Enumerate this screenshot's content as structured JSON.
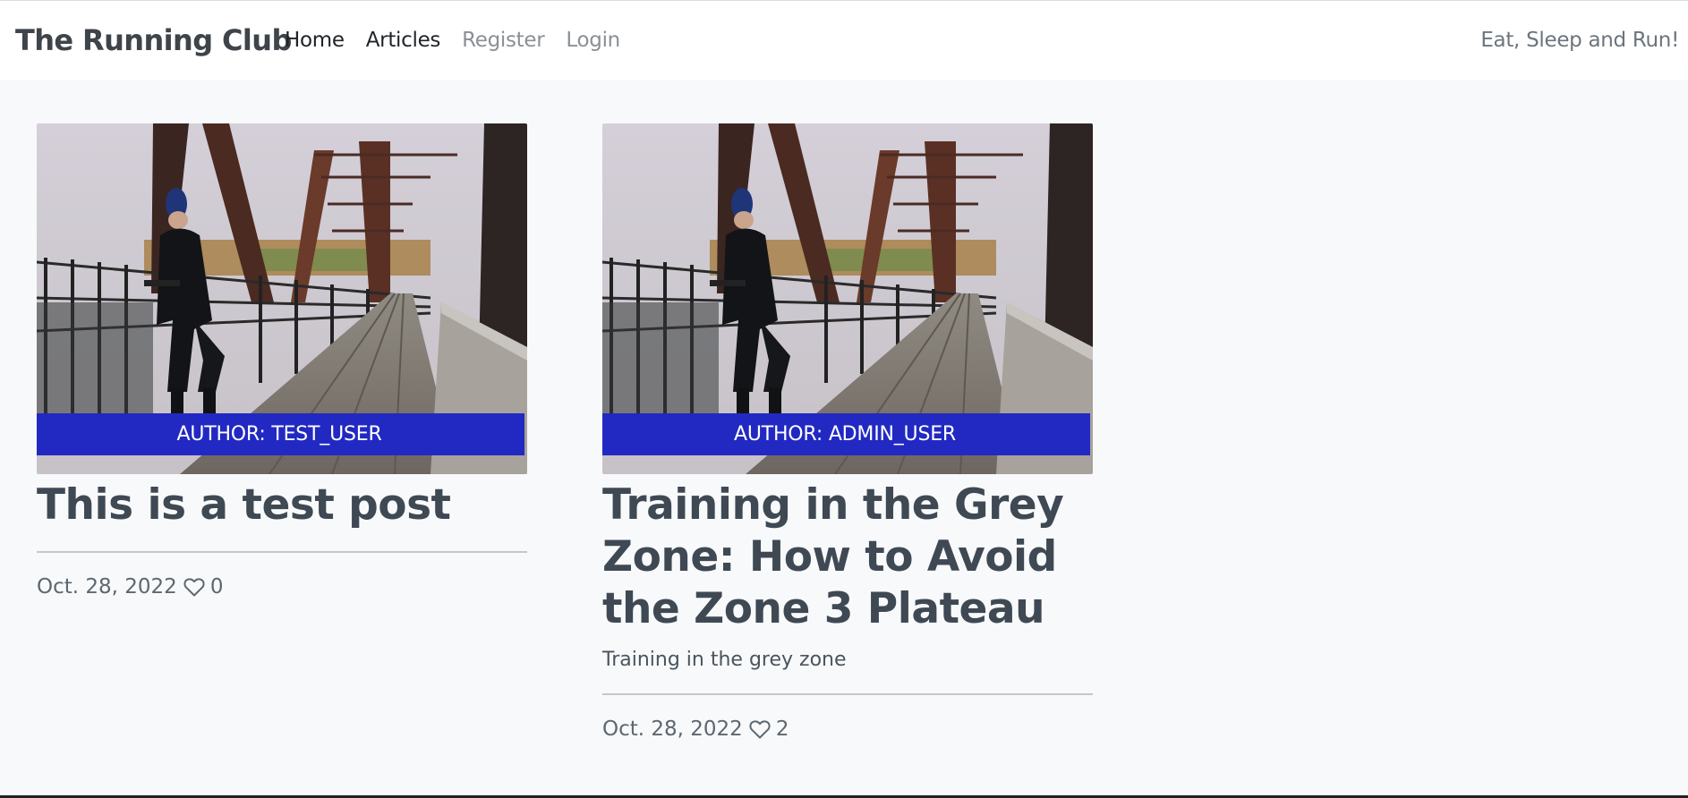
{
  "navbar": {
    "brand": "The Running Club",
    "links": [
      {
        "label": "Home",
        "state": "active"
      },
      {
        "label": "Articles",
        "state": "active"
      },
      {
        "label": "Register",
        "state": "muted"
      },
      {
        "label": "Login",
        "state": "muted"
      }
    ],
    "tagline": "Eat, Sleep and Run!"
  },
  "posts": [
    {
      "author_label": "AUTHOR: TEST_USER",
      "title": "This is a test post",
      "subtitle": "",
      "date": "Oct. 28, 2022",
      "likes": "0",
      "image": "runner-on-bridge-photo"
    },
    {
      "author_label": "AUTHOR: ADMIN_USER",
      "title": "Training in the Grey Zone: How to Avoid the Zone 3 Plateau",
      "subtitle": "Training in the grey zone",
      "date": "Oct. 28, 2022",
      "likes": "2",
      "image": "runner-on-bridge-photo"
    }
  ],
  "colors": {
    "author_band": "#2229c2",
    "background": "#f8f9fa",
    "navbar": "#ffffff",
    "title_text": "#3f4954"
  },
  "icons": {
    "like": "heart-outline-icon"
  }
}
